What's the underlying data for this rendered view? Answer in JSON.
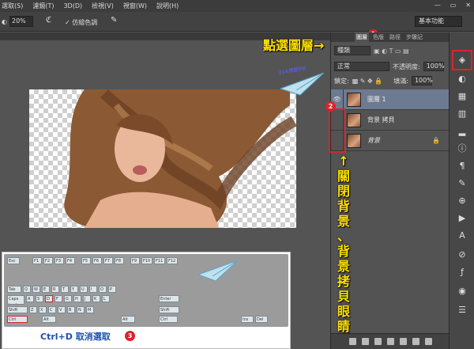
{
  "menu": [
    "選取(S)",
    "濾鏡(T)",
    "3D(D)",
    "檢視(V)",
    "視窗(W)",
    "說明(H)"
  ],
  "window_controls": [
    "—",
    "▭",
    "✕"
  ],
  "options": {
    "zoom": "20%",
    "checkbox_label": "✓ 仿繪色調",
    "workspace": "基本功能"
  },
  "panel": {
    "tabs": [
      "圖層",
      "色版",
      "路徑",
      "步驟記"
    ],
    "kind_label": "種類",
    "blend_mode": "正常",
    "opacity_label": "不透明度:",
    "opacity": "100%",
    "lock_label": "鎖定:",
    "fill_label": "填滿:",
    "fill": "100%"
  },
  "layers": [
    {
      "name": "圖層 1",
      "visible": true,
      "selected": true
    },
    {
      "name": "背景 拷貝",
      "visible": false,
      "selected": false
    },
    {
      "name": "背景",
      "visible": false,
      "selected": false,
      "locked": true
    }
  ],
  "annotations": {
    "select_layer": "點選圖層→",
    "badge1": "1",
    "badge2": "2",
    "badge3": "3",
    "close_eye": [
      "↑",
      "關",
      "閉",
      "背",
      "景",
      "、",
      "背",
      "景",
      "拷",
      "貝",
      "眼",
      "睛"
    ],
    "shortcut": "Ctrl+D 取消選取",
    "logo_text": "314學習手札"
  },
  "keyboard": {
    "keys": [
      "Esc",
      "F1",
      "F2",
      "F3",
      "F4",
      "F5",
      "F6",
      "F7",
      "F8",
      "F9",
      "F10",
      "F11",
      "F12",
      "Tab",
      "Q",
      "W",
      "E",
      "R",
      "T",
      "Y",
      "U",
      "I",
      "O",
      "P",
      "Caps Lock",
      "A",
      "S",
      "D",
      "F",
      "G",
      "H",
      "J",
      "K",
      "L",
      "Enter",
      "Shift",
      "Z",
      "X",
      "C",
      "V",
      "B",
      "N",
      "M",
      "Shift",
      "Ctrl",
      "Alt",
      "Alt",
      "Ctrl",
      "Ins",
      "Del"
    ]
  },
  "colors": {
    "accent_red": "#d8252b",
    "highlight_yellow": "#ffe100",
    "caption_blue": "#1a4fb0",
    "layer_selected": "#6d7b92"
  }
}
